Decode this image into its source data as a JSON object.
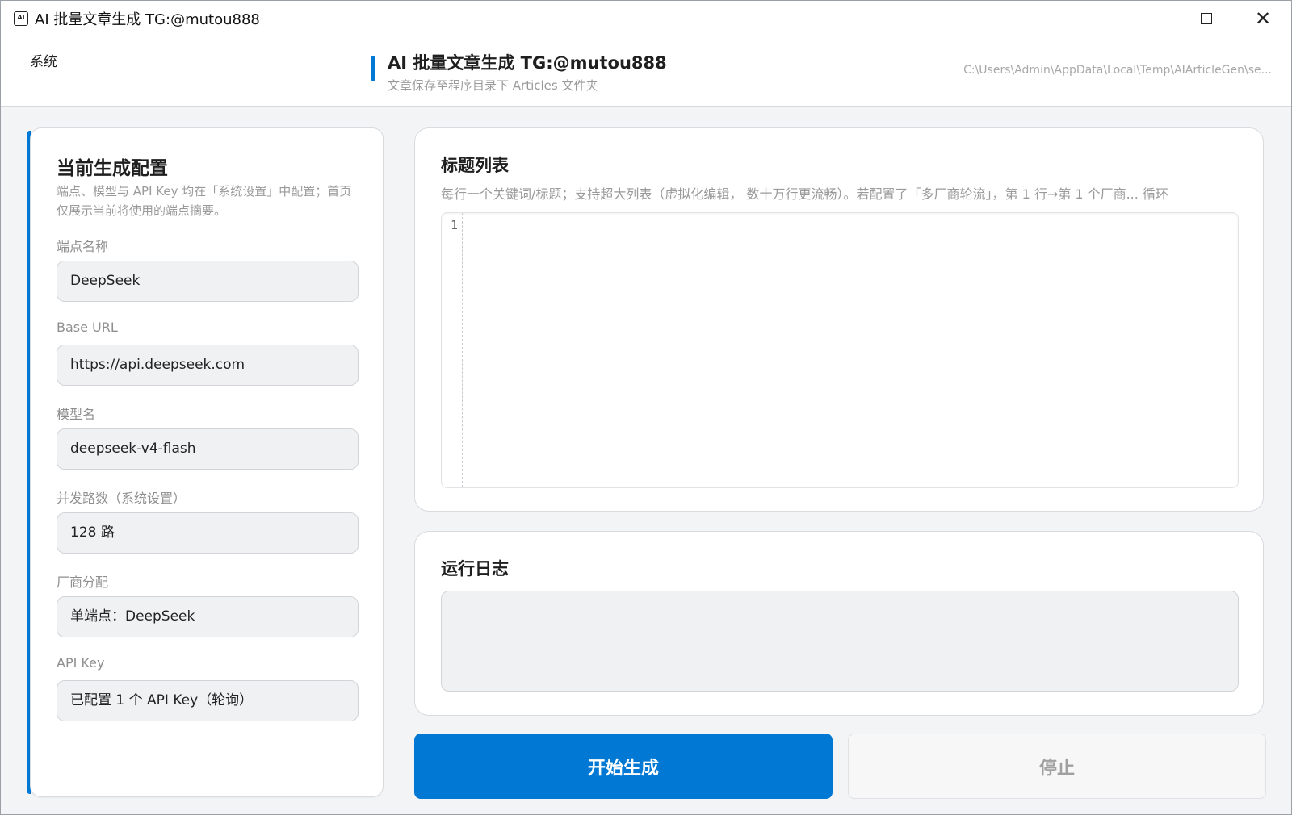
{
  "window": {
    "title": "AI 批量文章生成  TG:@mutou888",
    "app_icon_glyph": "AI",
    "controls": {
      "minimize_icon": "minimize-icon",
      "maximize_icon": "maximize-icon",
      "close_icon": "close-icon",
      "close_glyph": "✕"
    }
  },
  "header": {
    "menu_system": "系统",
    "title": "AI 批量文章生成  TG:@mutou888",
    "subtitle": "文章保存至程序目录下 Articles 文件夹",
    "path": "C:\\Users\\Admin\\AppData\\Local\\Temp\\AIArticleGen\\se..."
  },
  "config": {
    "title": "当前生成配置",
    "description": "端点、模型与 API Key 均在「系统设置」中配置；首页仅展示当前将使用的端点摘要。",
    "fields": [
      {
        "label": "端点名称",
        "value": "DeepSeek"
      },
      {
        "label": "Base URL",
        "value": "https://api.deepseek.com"
      },
      {
        "label": "模型名",
        "value": "deepseek-v4-flash"
      },
      {
        "label": "并发路数（系统设置）",
        "value": "128 路"
      },
      {
        "label": "厂商分配",
        "value": "单端点：DeepSeek"
      },
      {
        "label": "API Key",
        "value": "已配置 1 个 API Key（轮询）"
      }
    ]
  },
  "titles": {
    "title": "标题列表",
    "description": "每行一个关键词/标题；支持超大列表（虚拟化编辑， 数十万行更流畅）。若配置了「多厂商轮流」，第 1 行→第 1 个厂商... 循环",
    "line_number": "1"
  },
  "log": {
    "title": "运行日志"
  },
  "actions": {
    "start_label": "开始生成",
    "stop_label": "停止"
  },
  "colors": {
    "accent": "#0078d4",
    "stop_text": "#a0a0a0"
  }
}
